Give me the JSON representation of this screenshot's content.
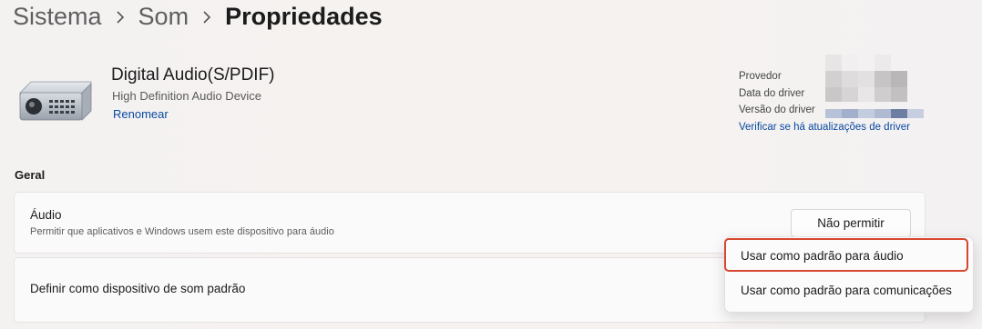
{
  "breadcrumb": {
    "items": [
      "Sistema",
      "Som"
    ],
    "current": "Propriedades"
  },
  "device": {
    "name": "Digital Audio(S/PDIF)",
    "description": "High Definition Audio Device",
    "rename_link": "Renomear"
  },
  "driver": {
    "provider_label": "Provedor",
    "date_label": "Data do driver",
    "version_label": "Versão do driver",
    "update_link": "Verificar se há atualizações de driver"
  },
  "general": {
    "section_title": "Geral",
    "audio": {
      "title": "Áudio",
      "description": "Permitir que aplicativos e Windows usem este dispositivo para áudio",
      "button_label": "Não permitir"
    },
    "default_device": {
      "title": "Definir como dispositivo de som padrão"
    }
  },
  "flyout": {
    "items": [
      "Usar como padrão para áudio",
      "Usar como padrão para comunicações"
    ],
    "highlight_color": "#d6472e"
  },
  "icons": [
    "chevron-right-icon",
    "audio-device-icon"
  ]
}
